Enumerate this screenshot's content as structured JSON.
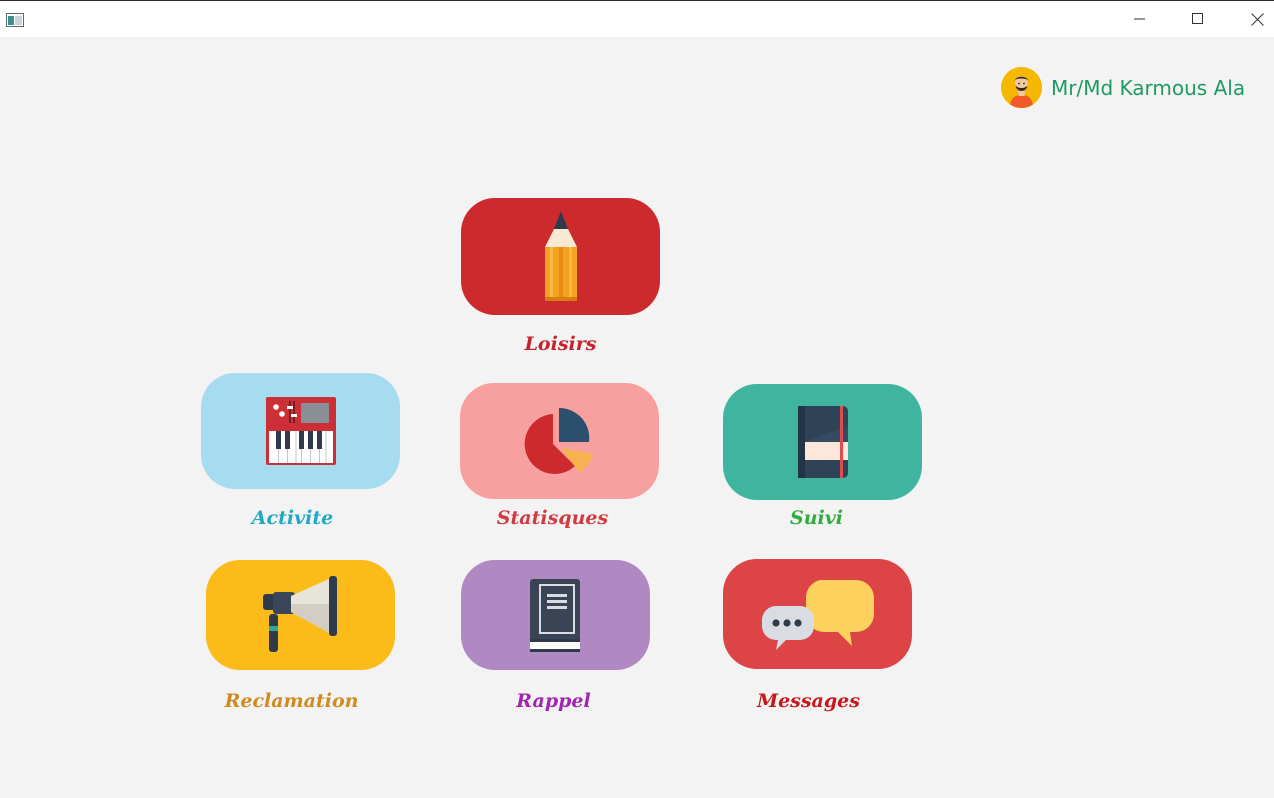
{
  "window": {
    "controls": {
      "minimize_icon": "minimize-icon",
      "maximize_icon": "maximize-icon",
      "close_icon": "close-icon"
    }
  },
  "user": {
    "name": "Mr/Md Karmous Ala",
    "name_color": "#1f9a63",
    "avatar_icon": "user-avatar-icon"
  },
  "tiles": {
    "loisirs": {
      "label": "Loisirs",
      "color": "#cc2a2d",
      "label_color": "#c8212c",
      "icon": "pencil-icon"
    },
    "activite": {
      "label": "Activite",
      "color": "#a5dcf0",
      "label_color": "#21a9c4",
      "icon": "synthesizer-icon"
    },
    "statisques": {
      "label": "Statisques",
      "color": "#f8a09f",
      "label_color": "#d33a3f",
      "icon": "pie-chart-icon"
    },
    "suivi": {
      "label": "Suivi",
      "color": "#3fb59f",
      "label_color": "#2fad3c",
      "icon": "notebook-icon"
    },
    "reclamation": {
      "label": "Reclamation",
      "color": "#fbbb18",
      "label_color": "#d08a1f",
      "icon": "megaphone-icon"
    },
    "rappel": {
      "label": "Rappel",
      "color": "#b088c2",
      "label_color": "#a126b0",
      "icon": "book-icon"
    },
    "messages": {
      "label": "Messages",
      "color": "#dc4446",
      "label_color": "#c8181e",
      "icon": "chat-bubbles-icon"
    }
  }
}
